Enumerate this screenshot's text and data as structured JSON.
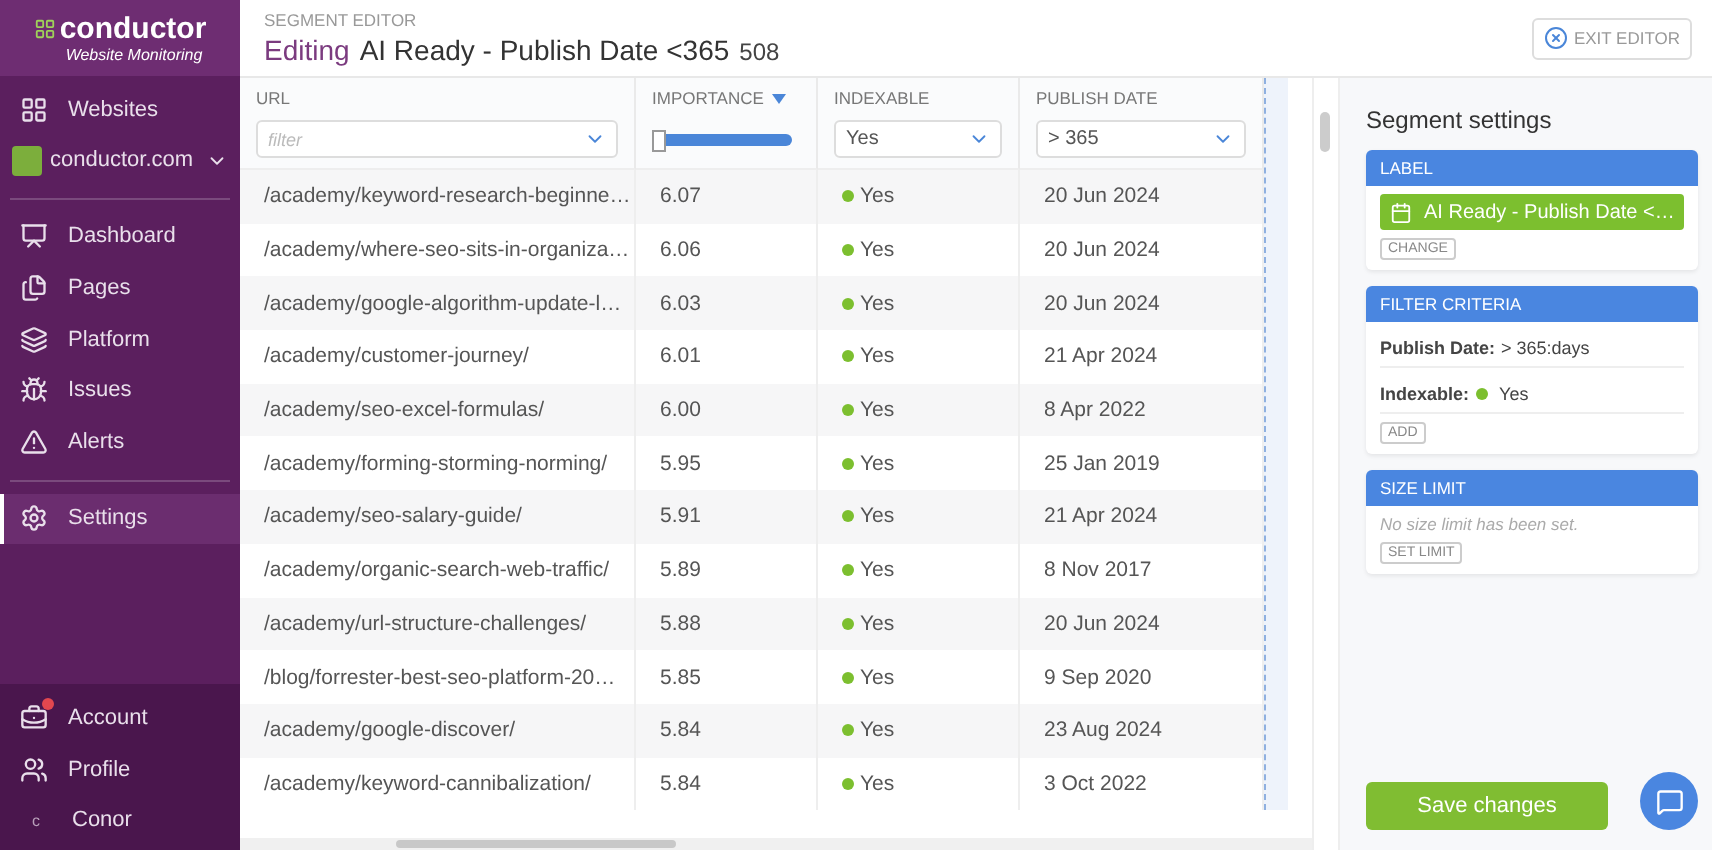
{
  "sidebar": {
    "logo": {
      "name": "conductor",
      "tagline": "Website Monitoring"
    },
    "websites": "Websites",
    "site": "conductor.com",
    "nav": [
      {
        "label": "Dashboard",
        "selected": false
      },
      {
        "label": "Pages",
        "selected": false
      },
      {
        "label": "Platform",
        "selected": false
      },
      {
        "label": "Issues",
        "selected": false
      },
      {
        "label": "Alerts",
        "selected": false
      },
      {
        "label": "Settings",
        "selected": true
      }
    ],
    "footer": [
      {
        "label": "Account",
        "kind": "account",
        "badge": true
      },
      {
        "label": "Profile",
        "kind": "profile",
        "badge": false
      },
      {
        "label": "Conor",
        "kind": "avatar",
        "initial": "c",
        "badge": false
      }
    ]
  },
  "header": {
    "section": "SEGMENT EDITOR",
    "mode": "Editing",
    "title": "AI Ready - Publish Date <365",
    "count": "508",
    "exit_button": "EXIT EDITOR"
  },
  "table": {
    "columns": [
      {
        "label": "URL",
        "sorted": false,
        "filter": {
          "kind": "text",
          "placeholder": "filter"
        }
      },
      {
        "label": "IMPORTANCE",
        "sorted": true,
        "filter": {
          "kind": "range",
          "level": 1
        }
      },
      {
        "label": "INDEXABLE",
        "sorted": false,
        "filter": {
          "kind": "select",
          "value": "Yes"
        }
      },
      {
        "label": "PUBLISH DATE",
        "sorted": false,
        "filter": {
          "kind": "select",
          "value": "> 365"
        }
      }
    ],
    "rows": [
      {
        "url": "/academy/keyword-research-beginne…",
        "importance": "6.07",
        "indexable": "Yes",
        "publish_date": "20 Jun 2024"
      },
      {
        "url": "/academy/where-seo-sits-in-organiza…",
        "importance": "6.06",
        "indexable": "Yes",
        "publish_date": "20 Jun 2024"
      },
      {
        "url": "/academy/google-algorithm-update-l…",
        "importance": "6.03",
        "indexable": "Yes",
        "publish_date": "20 Jun 2024"
      },
      {
        "url": "/academy/customer-journey/",
        "importance": "6.01",
        "indexable": "Yes",
        "publish_date": "21 Apr 2024"
      },
      {
        "url": "/academy/seo-excel-formulas/",
        "importance": "6.00",
        "indexable": "Yes",
        "publish_date": "8 Apr 2022"
      },
      {
        "url": "/academy/forming-storming-norming/",
        "importance": "5.95",
        "indexable": "Yes",
        "publish_date": "25 Jan 2019"
      },
      {
        "url": "/academy/seo-salary-guide/",
        "importance": "5.91",
        "indexable": "Yes",
        "publish_date": "21 Apr 2024"
      },
      {
        "url": "/academy/organic-search-web-traffic/",
        "importance": "5.89",
        "indexable": "Yes",
        "publish_date": "8 Nov 2017"
      },
      {
        "url": "/academy/url-structure-challenges/",
        "importance": "5.88",
        "indexable": "Yes",
        "publish_date": "20 Jun 2024"
      },
      {
        "url": "/blog/forrester-best-seo-platform-20…",
        "importance": "5.85",
        "indexable": "Yes",
        "publish_date": "9 Sep 2020"
      },
      {
        "url": "/academy/google-discover/",
        "importance": "5.84",
        "indexable": "Yes",
        "publish_date": "23 Aug 2024"
      },
      {
        "url": "/academy/keyword-cannibalization/",
        "importance": "5.84",
        "indexable": "Yes",
        "publish_date": "3 Oct 2022"
      }
    ]
  },
  "panel": {
    "title": "Segment settings",
    "label": {
      "heading": "LABEL",
      "tag": "AI Ready - Publish Date <…",
      "button": "CHANGE"
    },
    "filter": {
      "heading": "FILTER CRITERIA",
      "criteria": [
        {
          "name": "Publish Date:",
          "value": "> 365:days",
          "kind": "text"
        },
        {
          "name": "Indexable:",
          "value": "Yes",
          "kind": "dot"
        }
      ],
      "button": "ADD"
    },
    "size": {
      "heading": "SIZE LIMIT",
      "note": "No size limit has been set.",
      "button": "SET LIMIT"
    },
    "save_button": "Save changes"
  }
}
